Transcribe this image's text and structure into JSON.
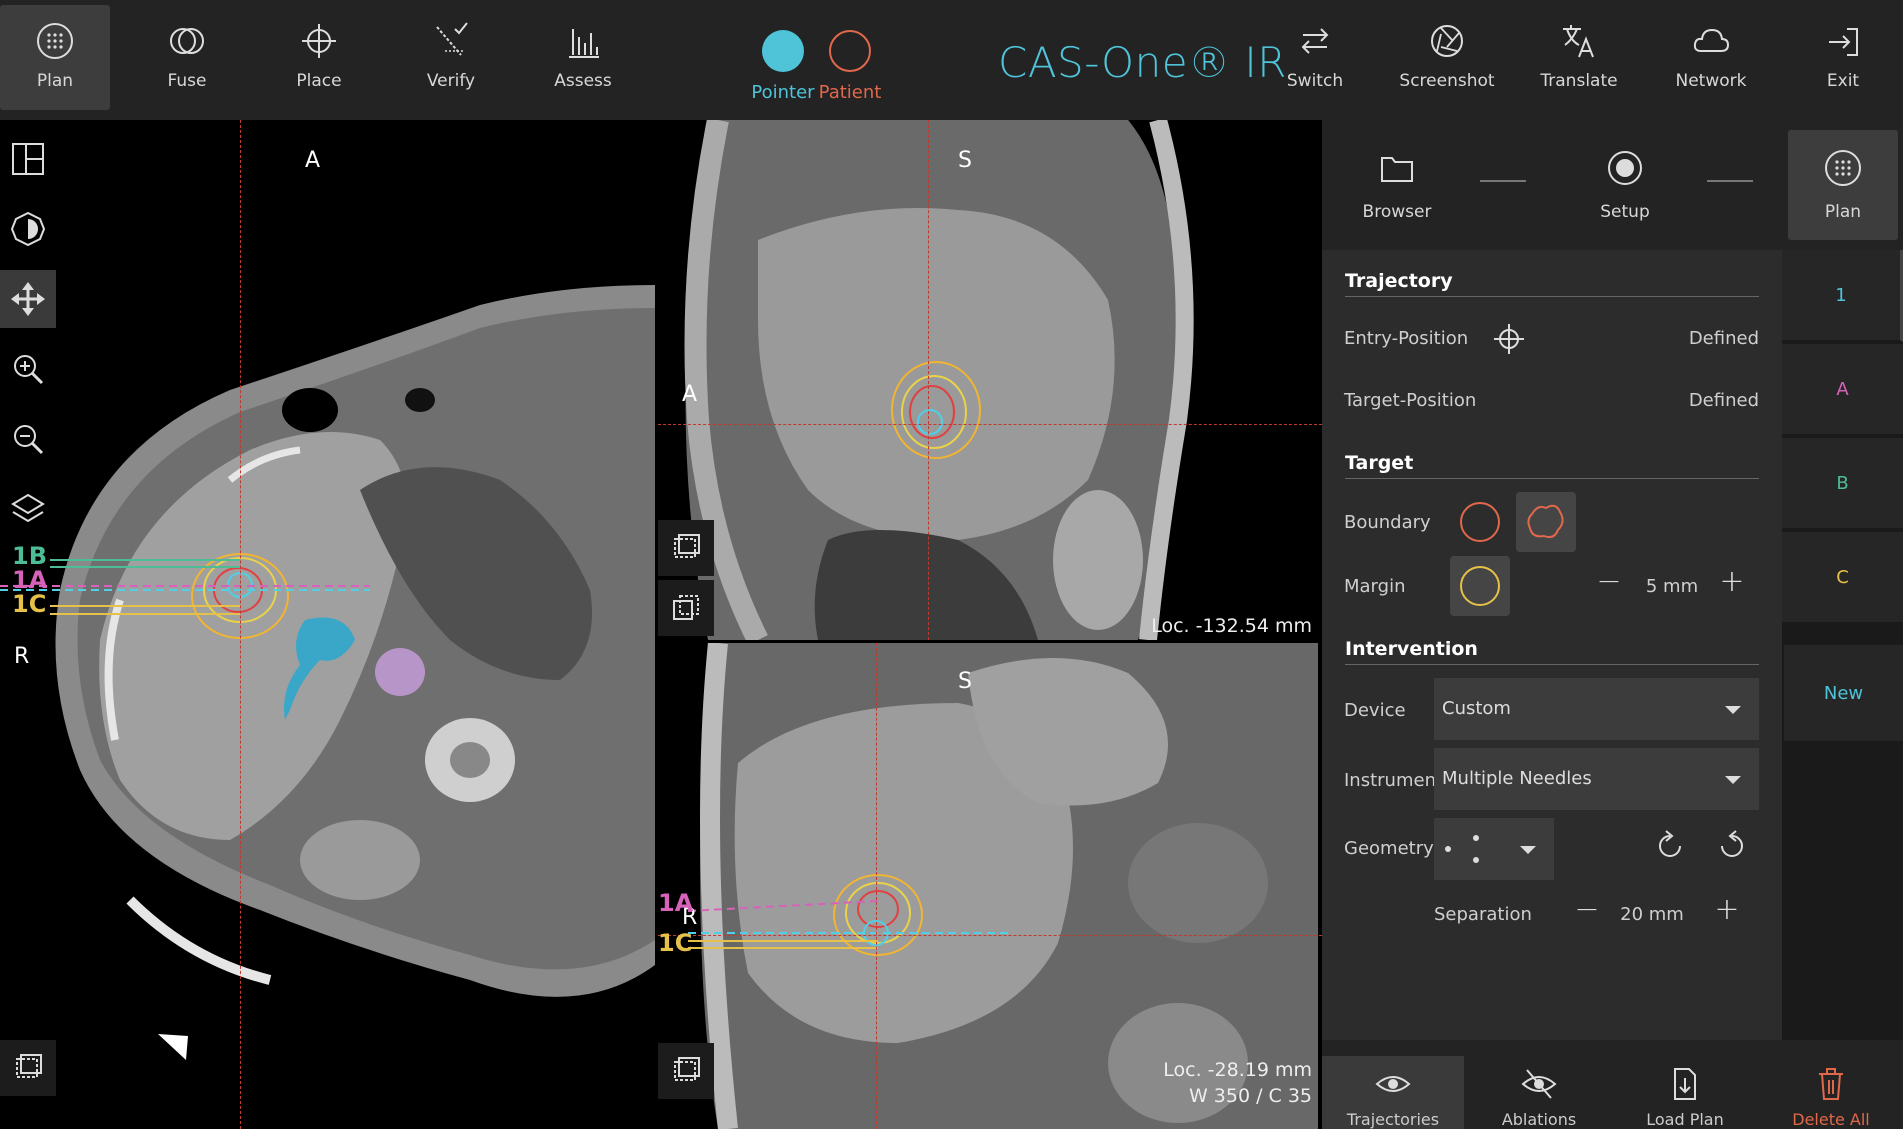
{
  "toolbar": {
    "left": [
      {
        "label": "Plan",
        "icon": "plan-icon",
        "active": true
      },
      {
        "label": "Fuse",
        "icon": "fuse-icon"
      },
      {
        "label": "Place",
        "icon": "crosshair-icon"
      },
      {
        "label": "Verify",
        "icon": "verify-icon"
      },
      {
        "label": "Assess",
        "icon": "bar-chart-icon"
      }
    ],
    "pointer_label": "Pointer",
    "patient_label": "Patient",
    "brand": "CAS-One® IR",
    "right": [
      {
        "label": "Switch",
        "icon": "switch-icon"
      },
      {
        "label": "Screenshot",
        "icon": "aperture-icon"
      },
      {
        "label": "Translate",
        "icon": "translate-icon"
      },
      {
        "label": "Network",
        "icon": "cloud-icon"
      },
      {
        "label": "Exit",
        "icon": "exit-icon"
      }
    ],
    "colors": {
      "pointer": "#4fc3d8",
      "patient": "#e0684b",
      "accent": "#4fc3d8"
    }
  },
  "left_tools": [
    "layout-icon",
    "window-level-icon",
    "pan-icon",
    "zoom-in-icon",
    "zoom-out-icon",
    "layers-icon"
  ],
  "viewports": {
    "axial": {
      "top": "A",
      "side": "R",
      "traj_labels": [
        "1B",
        "1A",
        "1C"
      ]
    },
    "sagittal": {
      "top": "S",
      "side": "A",
      "loc": "Loc. -132.54 mm"
    },
    "coronal": {
      "top": "S",
      "side": "R",
      "loc": "Loc. -28.19 mm",
      "wl": "W 350 / C 35",
      "traj_labels": [
        "1A",
        "1C"
      ]
    }
  },
  "wizard": [
    {
      "label": "Browser",
      "icon": "folder-icon"
    },
    {
      "label": "Setup",
      "icon": "record-icon"
    },
    {
      "label": "Plan",
      "icon": "plan-icon",
      "active": true
    }
  ],
  "panel": {
    "trajectory_title": "Trajectory",
    "entry_label": "Entry-Position",
    "entry_value": "Defined",
    "target_pos_label": "Target-Position",
    "target_pos_value": "Defined",
    "target_title": "Target",
    "boundary_label": "Boundary",
    "margin_label": "Margin",
    "margin_value": "5 mm",
    "intervention_title": "Intervention",
    "device_label": "Device",
    "device_value": "Custom",
    "instrument_label": "Instrument",
    "instrument_value": "Multiple Needles",
    "geometry_label": "Geometry",
    "separation_label": "Separation",
    "separation_value": "20 mm"
  },
  "traj_list": [
    {
      "label": "1",
      "color": "#4fc3d8"
    },
    {
      "label": "A",
      "color": "#d663b9"
    },
    {
      "label": "B",
      "color": "#4dbd96"
    },
    {
      "label": "C",
      "color": "#e5c14a"
    }
  ],
  "new_label": "New",
  "bottom": [
    {
      "label": "Trajectories",
      "icon": "eye-icon",
      "active": true
    },
    {
      "label": "Ablations",
      "icon": "eye-off-icon"
    },
    {
      "label": "Load Plan",
      "icon": "load-plan-icon"
    },
    {
      "label": "Delete All",
      "icon": "trash-icon",
      "color": "#e0684b"
    }
  ]
}
